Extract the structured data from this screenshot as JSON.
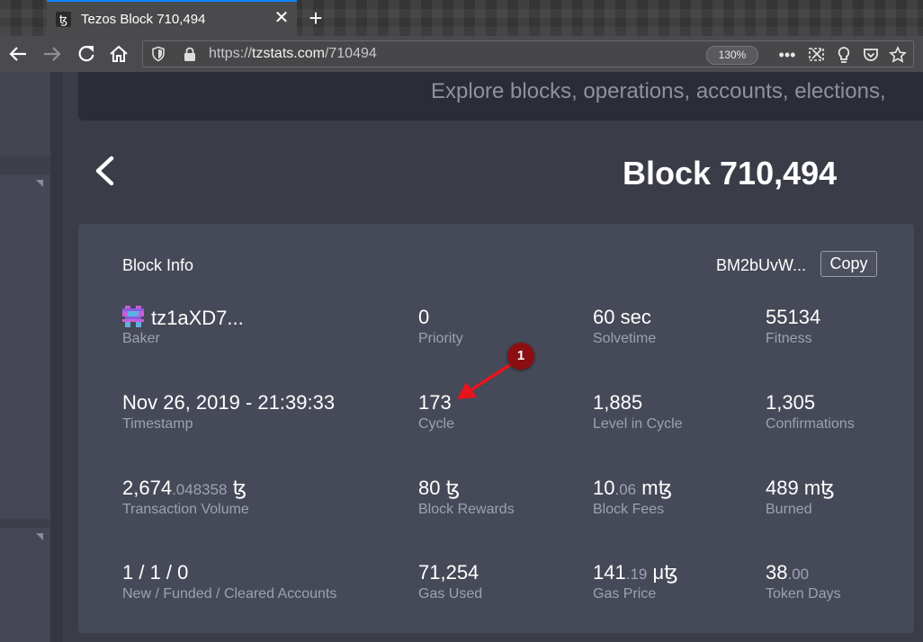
{
  "browser": {
    "tab_title": "Tezos Block 710,494",
    "tab_favicon": "ꜩ",
    "url_scheme": "https://",
    "url_host": "tzstats.com",
    "url_path": "/710494",
    "zoom": "130%"
  },
  "banner": {
    "text": "Explore blocks, operations, accounts, elections,"
  },
  "page": {
    "title": "Block 710,494"
  },
  "card": {
    "heading": "Block Info",
    "hash": "BM2bUvW...",
    "copy_label": "Copy"
  },
  "stats": [
    [
      {
        "value": "tz1aXD7...",
        "label": "Baker"
      },
      {
        "value": "0",
        "label": "Priority"
      },
      {
        "value": "60 sec",
        "label": "Solvetime"
      },
      {
        "value": "55134",
        "label": "Fitness"
      }
    ],
    [
      {
        "value": "Nov 26, 2019 - 21:39:33",
        "label": "Timestamp"
      },
      {
        "value": "173",
        "label": "Cycle"
      },
      {
        "value": "1,885",
        "label": "Level in Cycle"
      },
      {
        "value": "1,305",
        "label": "Confirmations"
      }
    ],
    [
      {
        "int": "2,674",
        "dec": ".048358",
        "unit": " ꜩ",
        "label": "Transaction Volume"
      },
      {
        "int": "80",
        "dec": "",
        "unit": " ꜩ",
        "label": "Block Rewards"
      },
      {
        "int": "10",
        "dec": ".06",
        "unit": " mꜩ",
        "label": "Block Fees"
      },
      {
        "int": "489",
        "dec": "",
        "unit": " mꜩ",
        "label": "Burned"
      }
    ],
    [
      {
        "int": "1 / 1 / 0",
        "dec": "",
        "unit": "",
        "label": "New / Funded / Cleared Accounts"
      },
      {
        "int": "71,254",
        "dec": "",
        "unit": "",
        "label": "Gas Used"
      },
      {
        "int": "141",
        "dec": ".19",
        "unit": " μꜩ",
        "label": "Gas Price"
      },
      {
        "int": "38",
        "dec": ".00",
        "unit": "",
        "label": "Token Days"
      }
    ]
  ],
  "annotation": {
    "badge": "1",
    "color": "#e8141c"
  },
  "icons": {
    "back": "arrow-left-icon",
    "forward": "arrow-right-icon",
    "reload": "reload-icon",
    "home": "home-icon",
    "shield": "shield-icon",
    "lock": "lock-icon",
    "more": "more-icon",
    "screenshot": "screenshot-icon",
    "idea": "lightbulb-icon",
    "pocket": "pocket-icon",
    "star": "star-icon"
  }
}
